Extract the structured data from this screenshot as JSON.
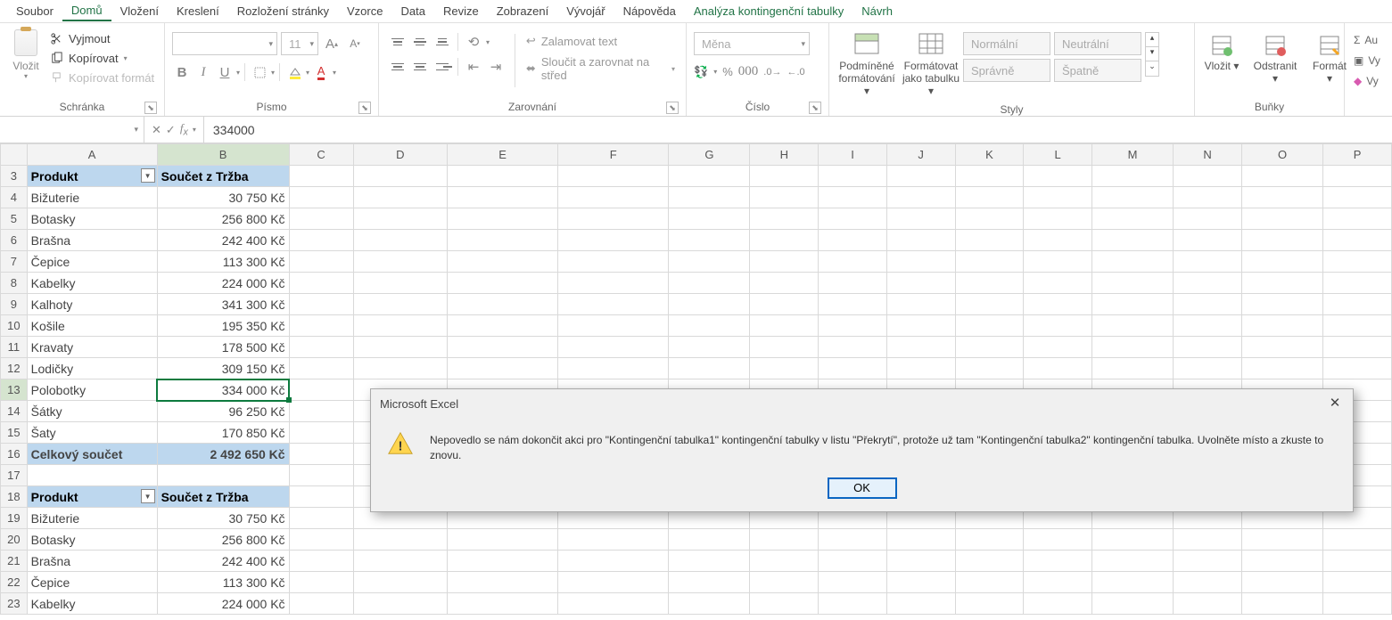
{
  "menu": {
    "items": [
      "Soubor",
      "Domů",
      "Vložení",
      "Kreslení",
      "Rozložení stránky",
      "Vzorce",
      "Data",
      "Revize",
      "Zobrazení",
      "Vývojář",
      "Nápověda"
    ],
    "contextual": [
      "Analýza kontingenční tabulky",
      "Návrh"
    ],
    "activeIndex": 1
  },
  "ribbon": {
    "clipboard": {
      "paste": "Vložit",
      "cut": "Vyjmout",
      "copy": "Kopírovat",
      "fmtpaint": "Kopírovat formát",
      "label": "Schránka"
    },
    "font": {
      "namePlaceholder": "",
      "sizePlaceholder": "11",
      "label": "Písmo"
    },
    "alignment": {
      "wrap": "Zalamovat text",
      "merge": "Sloučit a zarovnat na střed",
      "label": "Zarovnání"
    },
    "number": {
      "formatPlaceholder": "Měna",
      "label": "Číslo"
    },
    "styles": {
      "condfmt_l1": "Podmíněné",
      "condfmt_l2": "formátování",
      "astable_l1": "Formátovat",
      "astable_l2": "jako tabulku",
      "s1": "Normální",
      "s2": "Neutrální",
      "s3": "Správně",
      "s4": "Špatně",
      "label": "Styly"
    },
    "cells": {
      "insert": "Vložit",
      "delete": "Odstranit",
      "format": "Formát",
      "label": "Buňky"
    },
    "editing": {
      "autosum": "Au",
      "fill": "Vy",
      "clear": "Vy"
    }
  },
  "formulaBar": {
    "nameBox": "",
    "value": "334000"
  },
  "columns": [
    "",
    "A",
    "B",
    "C",
    "D",
    "E",
    "F",
    "G",
    "H",
    "I",
    "J",
    "K",
    "L",
    "M",
    "N",
    "O",
    "P"
  ],
  "rows": [
    {
      "n": 3,
      "a": "Produkt",
      "b": "Součet z Tržba",
      "hdr": true
    },
    {
      "n": 4,
      "a": "Bižuterie",
      "b": "30 750 Kč"
    },
    {
      "n": 5,
      "a": "Botasky",
      "b": "256 800 Kč"
    },
    {
      "n": 6,
      "a": "Brašna",
      "b": "242 400 Kč"
    },
    {
      "n": 7,
      "a": "Čepice",
      "b": "113 300 Kč"
    },
    {
      "n": 8,
      "a": "Kabelky",
      "b": "224 000 Kč"
    },
    {
      "n": 9,
      "a": "Kalhoty",
      "b": "341 300 Kč"
    },
    {
      "n": 10,
      "a": "Košile",
      "b": "195 350 Kč"
    },
    {
      "n": 11,
      "a": "Kravaty",
      "b": "178 500 Kč"
    },
    {
      "n": 12,
      "a": "Lodičky",
      "b": "309 150 Kč"
    },
    {
      "n": 13,
      "a": "Polobotky",
      "b": "334 000 Kč",
      "selected": true
    },
    {
      "n": 14,
      "a": "Šátky",
      "b": "96 250 Kč"
    },
    {
      "n": 15,
      "a": "Šaty",
      "b": "170 850 Kč"
    },
    {
      "n": 16,
      "a": "Celkový součet",
      "b": "2 492 650 Kč",
      "total": true
    },
    {
      "n": 17,
      "a": "",
      "b": ""
    },
    {
      "n": 18,
      "a": "Produkt",
      "b": "Součet z Tržba",
      "hdr": true
    },
    {
      "n": 19,
      "a": "Bižuterie",
      "b": "30 750 Kč"
    },
    {
      "n": 20,
      "a": "Botasky",
      "b": "256 800 Kč"
    },
    {
      "n": 21,
      "a": "Brašna",
      "b": "242 400 Kč"
    },
    {
      "n": 22,
      "a": "Čepice",
      "b": "113 300 Kč"
    },
    {
      "n": 23,
      "a": "Kabelky",
      "b": "224 000 Kč"
    }
  ],
  "dialog": {
    "title": "Microsoft Excel",
    "message": "Nepovedlo se nám dokončit akci pro \"Kontingenční tabulka1\" kontingenční tabulky v listu \"Překrytí\", protože už tam \"Kontingenční tabulka2\" kontingenční tabulka. Uvolněte místo a zkuste to znovu.",
    "ok": "OK"
  }
}
